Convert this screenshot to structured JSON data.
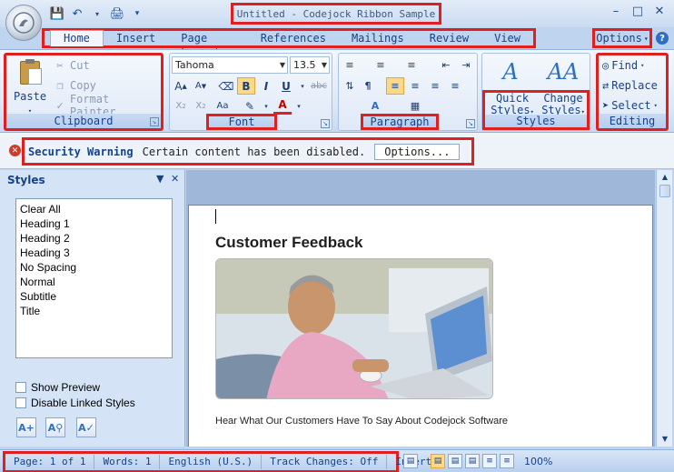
{
  "window": {
    "title": "Untitled - Codejock Ribbon Sample"
  },
  "tabs": [
    {
      "label": "Home",
      "active": true
    },
    {
      "label": "Insert"
    },
    {
      "label": "Page Layout"
    },
    {
      "label": "References"
    },
    {
      "label": "Mailings"
    },
    {
      "label": "Review"
    },
    {
      "label": "View"
    }
  ],
  "options_menu": {
    "label": "Options"
  },
  "help": {
    "glyph": "?"
  },
  "clipboard": {
    "group_label": "Clipboard",
    "paste": "Paste",
    "cut": "Cut",
    "copy": "Copy",
    "format_painter": "Format Painter"
  },
  "font": {
    "group_label": "Font",
    "family": "Tahoma",
    "size": "13.5"
  },
  "paragraph": {
    "group_label": "Paragraph"
  },
  "styles_group": {
    "group_label": "Styles",
    "quick_styles_line1": "Quick",
    "quick_styles_line2": "Styles",
    "change_styles_line1": "Change",
    "change_styles_line2": "Styles"
  },
  "editing": {
    "group_label": "Editing",
    "find": "Find",
    "replace": "Replace",
    "select": "Select"
  },
  "security_bar": {
    "title": "Security Warning",
    "message": "Certain content has been disabled.",
    "options_button": "Options..."
  },
  "styles_pane": {
    "title": "Styles",
    "items": [
      "Clear All",
      "Heading 1",
      "Heading 2",
      "Heading 3",
      "No Spacing",
      "Normal",
      "Subtitle",
      "Title"
    ],
    "show_preview": "Show Preview",
    "disable_linked": "Disable Linked Styles"
  },
  "document": {
    "heading": "Customer Feedback",
    "body": "Hear What Our Customers Have To Say About Codejock Software"
  },
  "statusbar": {
    "page": "Page: 1 of 1",
    "words": "Words: 1",
    "language": "English (U.S.)",
    "track_changes": "Track Changes: Off",
    "mode": "Insert",
    "zoom": "100%"
  },
  "colors": {
    "highlight_border": "#e0201f",
    "ribbon_text": "#15428b",
    "active_button": "#fbd987"
  }
}
